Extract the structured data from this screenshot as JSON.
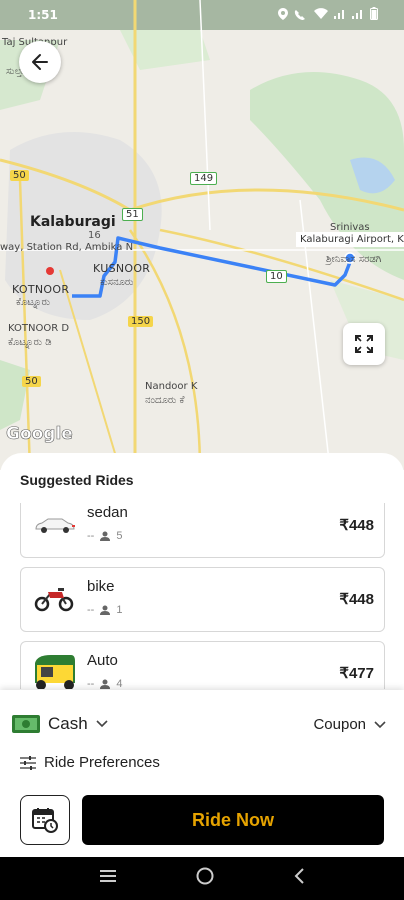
{
  "status": {
    "time": "1:51"
  },
  "map": {
    "labels": {
      "taj": "Taj Sultanpur",
      "taj_kn": "ಸುಲ್ತಾನ್",
      "kalaburagi": "Kalaburagi",
      "station_road": "way, Station Rd, Ambika N",
      "kusnoor": "KUSNOOR",
      "kusnoor_kn": "ಕುಸನೂರು",
      "kotnoor": "KOTNOOR",
      "kotnoor_kn": "ಕೊಟ್ನೂರು",
      "kotnoor_d": "KOTNOOR D",
      "kotnoor_d_kn": "ಕೊಟ್ನೂರು ಡಿ",
      "nandoor": "Nandoor K",
      "nandoor_kn": "ನಂದೂರು ಕೆ",
      "srinivas": "Srinivas",
      "srinivas_kn": "ಶ್ರೀನಿವಾಸ ಸರಡಗಿ",
      "airport": "Kalaburagi Airport, Kala",
      "hwy_50a": "50",
      "hwy_50b": "50",
      "hwy_149": "149",
      "hwy_51": "51",
      "hwy_10": "10",
      "hwy_150": "150",
      "hwy_16": "16",
      "google": "Google"
    }
  },
  "sheet": {
    "title": "Suggested Rides",
    "rides": [
      {
        "name": "sedan",
        "dash": "--",
        "seats": "5",
        "price": "₹448"
      },
      {
        "name": "bike",
        "dash": "--",
        "seats": "1",
        "price": "₹448"
      },
      {
        "name": "Auto",
        "dash": "--",
        "seats": "4",
        "price": "₹477"
      }
    ]
  },
  "bottom": {
    "payment": "Cash",
    "coupon": "Coupon",
    "preferences": "Ride Preferences",
    "ride_now": "Ride Now"
  },
  "colors": {
    "accent": "#e6a300",
    "route": "#3b82f6",
    "button_bg": "#000000"
  }
}
